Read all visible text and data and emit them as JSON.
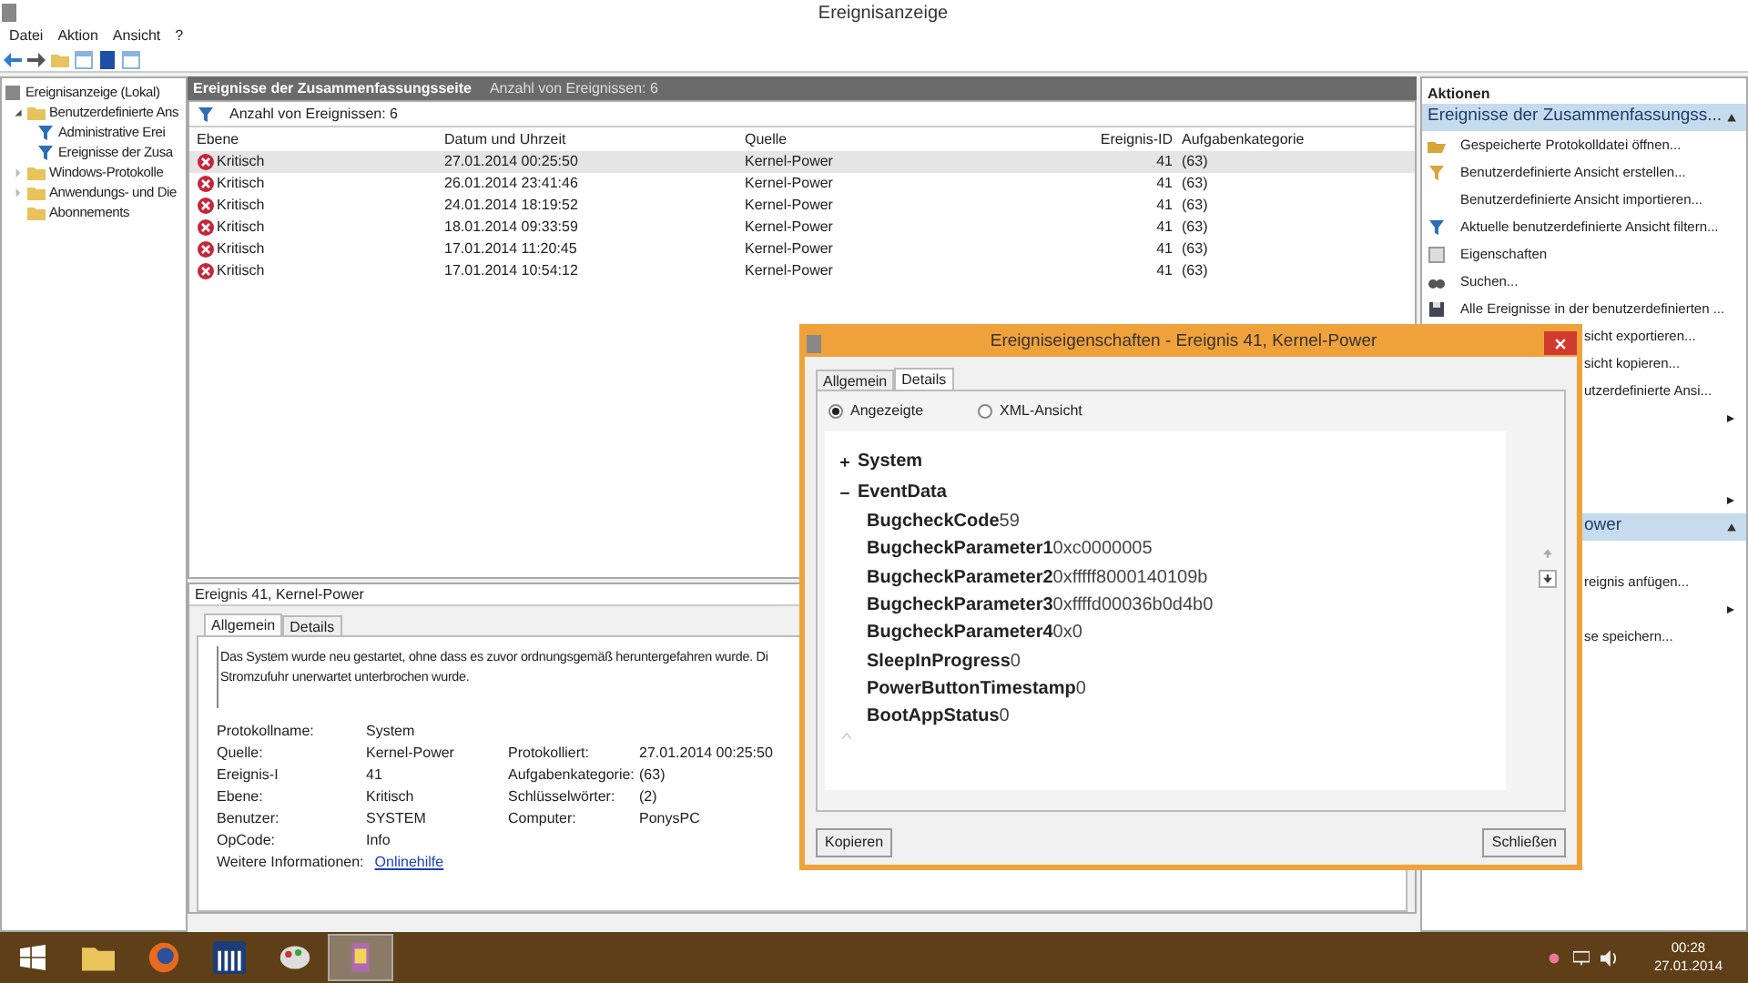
{
  "window": {
    "title": "Ereignisanzeige"
  },
  "menu": [
    "Datei",
    "Aktion",
    "Ansicht",
    "?"
  ],
  "tree": [
    {
      "label": "Ereignisanzeige (Lokal)",
      "children": [
        {
          "label": "Benutzerdefinierte Ans",
          "expanded": true,
          "children": [
            {
              "label": "Administrative Erei"
            },
            {
              "label": "Ereignisse der Zusa"
            }
          ]
        },
        {
          "label": "Windows-Protokolle",
          "expanded": false
        },
        {
          "label": "Anwendungs- und Die",
          "expanded": false
        },
        {
          "label": "Abonnements"
        }
      ]
    }
  ],
  "center": {
    "title": "Ereignisse der Zusammenfassungsseite",
    "count": "Anzahl von Ereignissen: 6",
    "filter": "Anzahl von Ereignissen: 6",
    "table": {
      "columns": [
        "Ebene",
        "Datum und Uhrzeit",
        "Quelle",
        "Ereignis-ID",
        "Aufgabenkategorie"
      ],
      "rows": [
        {
          "level": "Kritisch",
          "date": "27.01.2014 00:25:50",
          "source": "Kernel-Power",
          "id": "41",
          "category": "(63)",
          "selected": true
        },
        {
          "level": "Kritisch",
          "date": "26.01.2014 23:41:46",
          "source": "Kernel-Power",
          "id": "41",
          "category": "(63)",
          "selected": false
        },
        {
          "level": "Kritisch",
          "date": "24.01.2014 18:19:52",
          "source": "Kernel-Power",
          "id": "41",
          "category": "(63)",
          "selected": false
        },
        {
          "level": "Kritisch",
          "date": "18.01.2014 09:33:59",
          "source": "Kernel-Power",
          "id": "41",
          "category": "(63)",
          "selected": false
        },
        {
          "level": "Kritisch",
          "date": "17.01.2014 11:20:45",
          "source": "Kernel-Power",
          "id": "41",
          "category": "(63)",
          "selected": false
        },
        {
          "level": "Kritisch",
          "date": "17.01.2014 10:54:12",
          "source": "Kernel-Power",
          "id": "41",
          "category": "(63)",
          "selected": false
        }
      ]
    }
  },
  "preview": {
    "title": "Ereignis 41, Kernel-Power",
    "tabs": [
      {
        "label": "Allgemein",
        "selected": true
      },
      {
        "label": "Details",
        "selected": false
      }
    ],
    "description": "Das System wurde neu gestartet, ohne dass es zuvor ordnungsgemäß heruntergefahren wurde. Di\nStromzufuhr unerwartet unterbrochen wurde.",
    "fields": [
      {
        "label": "Protokollname:",
        "value": "System"
      },
      {
        "label": "Quelle:",
        "value": "Kernel-Power",
        "label2": "Protokolliert:",
        "value2": "27.01.2014 00:25:50"
      },
      {
        "label": "Ereignis-I",
        "value": "41",
        "label2": "Aufgabenkategorie:",
        "value2": "(63)"
      },
      {
        "label": "Ebene:",
        "value": "Kritisch",
        "label2": "Schlüsselwörter:",
        "value2": "(2)"
      },
      {
        "label": "Benutzer:",
        "value": "SYSTEM",
        "label2": "Computer:",
        "value2": "PonysPC"
      },
      {
        "label": "OpCode:",
        "value": "Info"
      }
    ],
    "more_info": {
      "label": "Weitere Informationen:",
      "link": "Onlinehilfe"
    }
  },
  "actions": {
    "title": "Aktionen",
    "sections": [
      {
        "title": "Ereignisse der Zusammenfassungss...",
        "kind": "full",
        "expanded": true,
        "items": [
          {
            "kind": "action",
            "label": "Gespeicherte Protokolldatei öffnen..."
          },
          {
            "kind": "action",
            "label": "Benutzerdefinierte Ansicht erstellen..."
          },
          {
            "kind": "action",
            "label": "Benutzerdefinierte Ansicht importieren..."
          },
          {
            "kind": "action",
            "label": "Aktuelle benutzerdefinierte Ansicht filtern..."
          },
          {
            "kind": "action",
            "label": "Eigenschaften"
          },
          {
            "kind": "action",
            "label": "Suchen..."
          },
          {
            "kind": "action",
            "label": "Alle Ereignisse in der benutzerdefinierten ..."
          },
          {
            "kind": "partial",
            "label": "sicht exportieren..."
          },
          {
            "kind": "partial",
            "label": "sicht kopieren..."
          },
          {
            "kind": "partial",
            "label": "utzerdefinierte Ansi..."
          },
          {
            "kind": "submenu"
          },
          {
            "kind": "blank"
          },
          {
            "kind": "blank"
          },
          {
            "kind": "submenu"
          }
        ]
      },
      {
        "title": "ower",
        "kind": "partial",
        "expanded": true,
        "items": [
          {
            "kind": "blank"
          },
          {
            "kind": "partial",
            "label": "reignis anfügen..."
          },
          {
            "kind": "submenu"
          },
          {
            "kind": "partial",
            "label": "se speichern..."
          }
        ]
      }
    ]
  },
  "dialog": {
    "title": "Ereigniseigenschaften - Ereignis 41, Kernel-Power",
    "tabs": [
      {
        "label": "Allgemein",
        "selected": false
      },
      {
        "label": "Details",
        "selected": true
      }
    ],
    "views": [
      {
        "label": "Angezeigte",
        "selected": true
      },
      {
        "label": "XML-Ansicht",
        "selected": false
      }
    ],
    "tree": [
      {
        "label": "System",
        "expanded": false
      },
      {
        "label": "EventData",
        "expanded": true,
        "children": [
          {
            "name": "BugcheckCode",
            "value": "59"
          },
          {
            "name": "BugcheckParameter1",
            "value": "0xc0000005"
          },
          {
            "name": "BugcheckParameter2",
            "value": "0xfffff8000140109b"
          },
          {
            "name": "BugcheckParameter3",
            "value": "0xffffd00036b0d4b0"
          },
          {
            "name": "BugcheckParameter4",
            "value": "0x0"
          },
          {
            "name": "SleepInProgress",
            "value": "0"
          },
          {
            "name": "PowerButtonTimestamp",
            "value": "0"
          },
          {
            "name": "BootAppStatus",
            "value": "0"
          }
        ]
      }
    ],
    "buttons": [
      "Kopieren",
      "Schließen"
    ]
  },
  "taskbar": {
    "apps": [
      {
        "selected": false
      },
      {
        "selected": false
      },
      {
        "selected": false
      },
      {
        "selected": false
      },
      {
        "selected": true
      }
    ],
    "time": "00:28",
    "date": "27.01.2014"
  }
}
